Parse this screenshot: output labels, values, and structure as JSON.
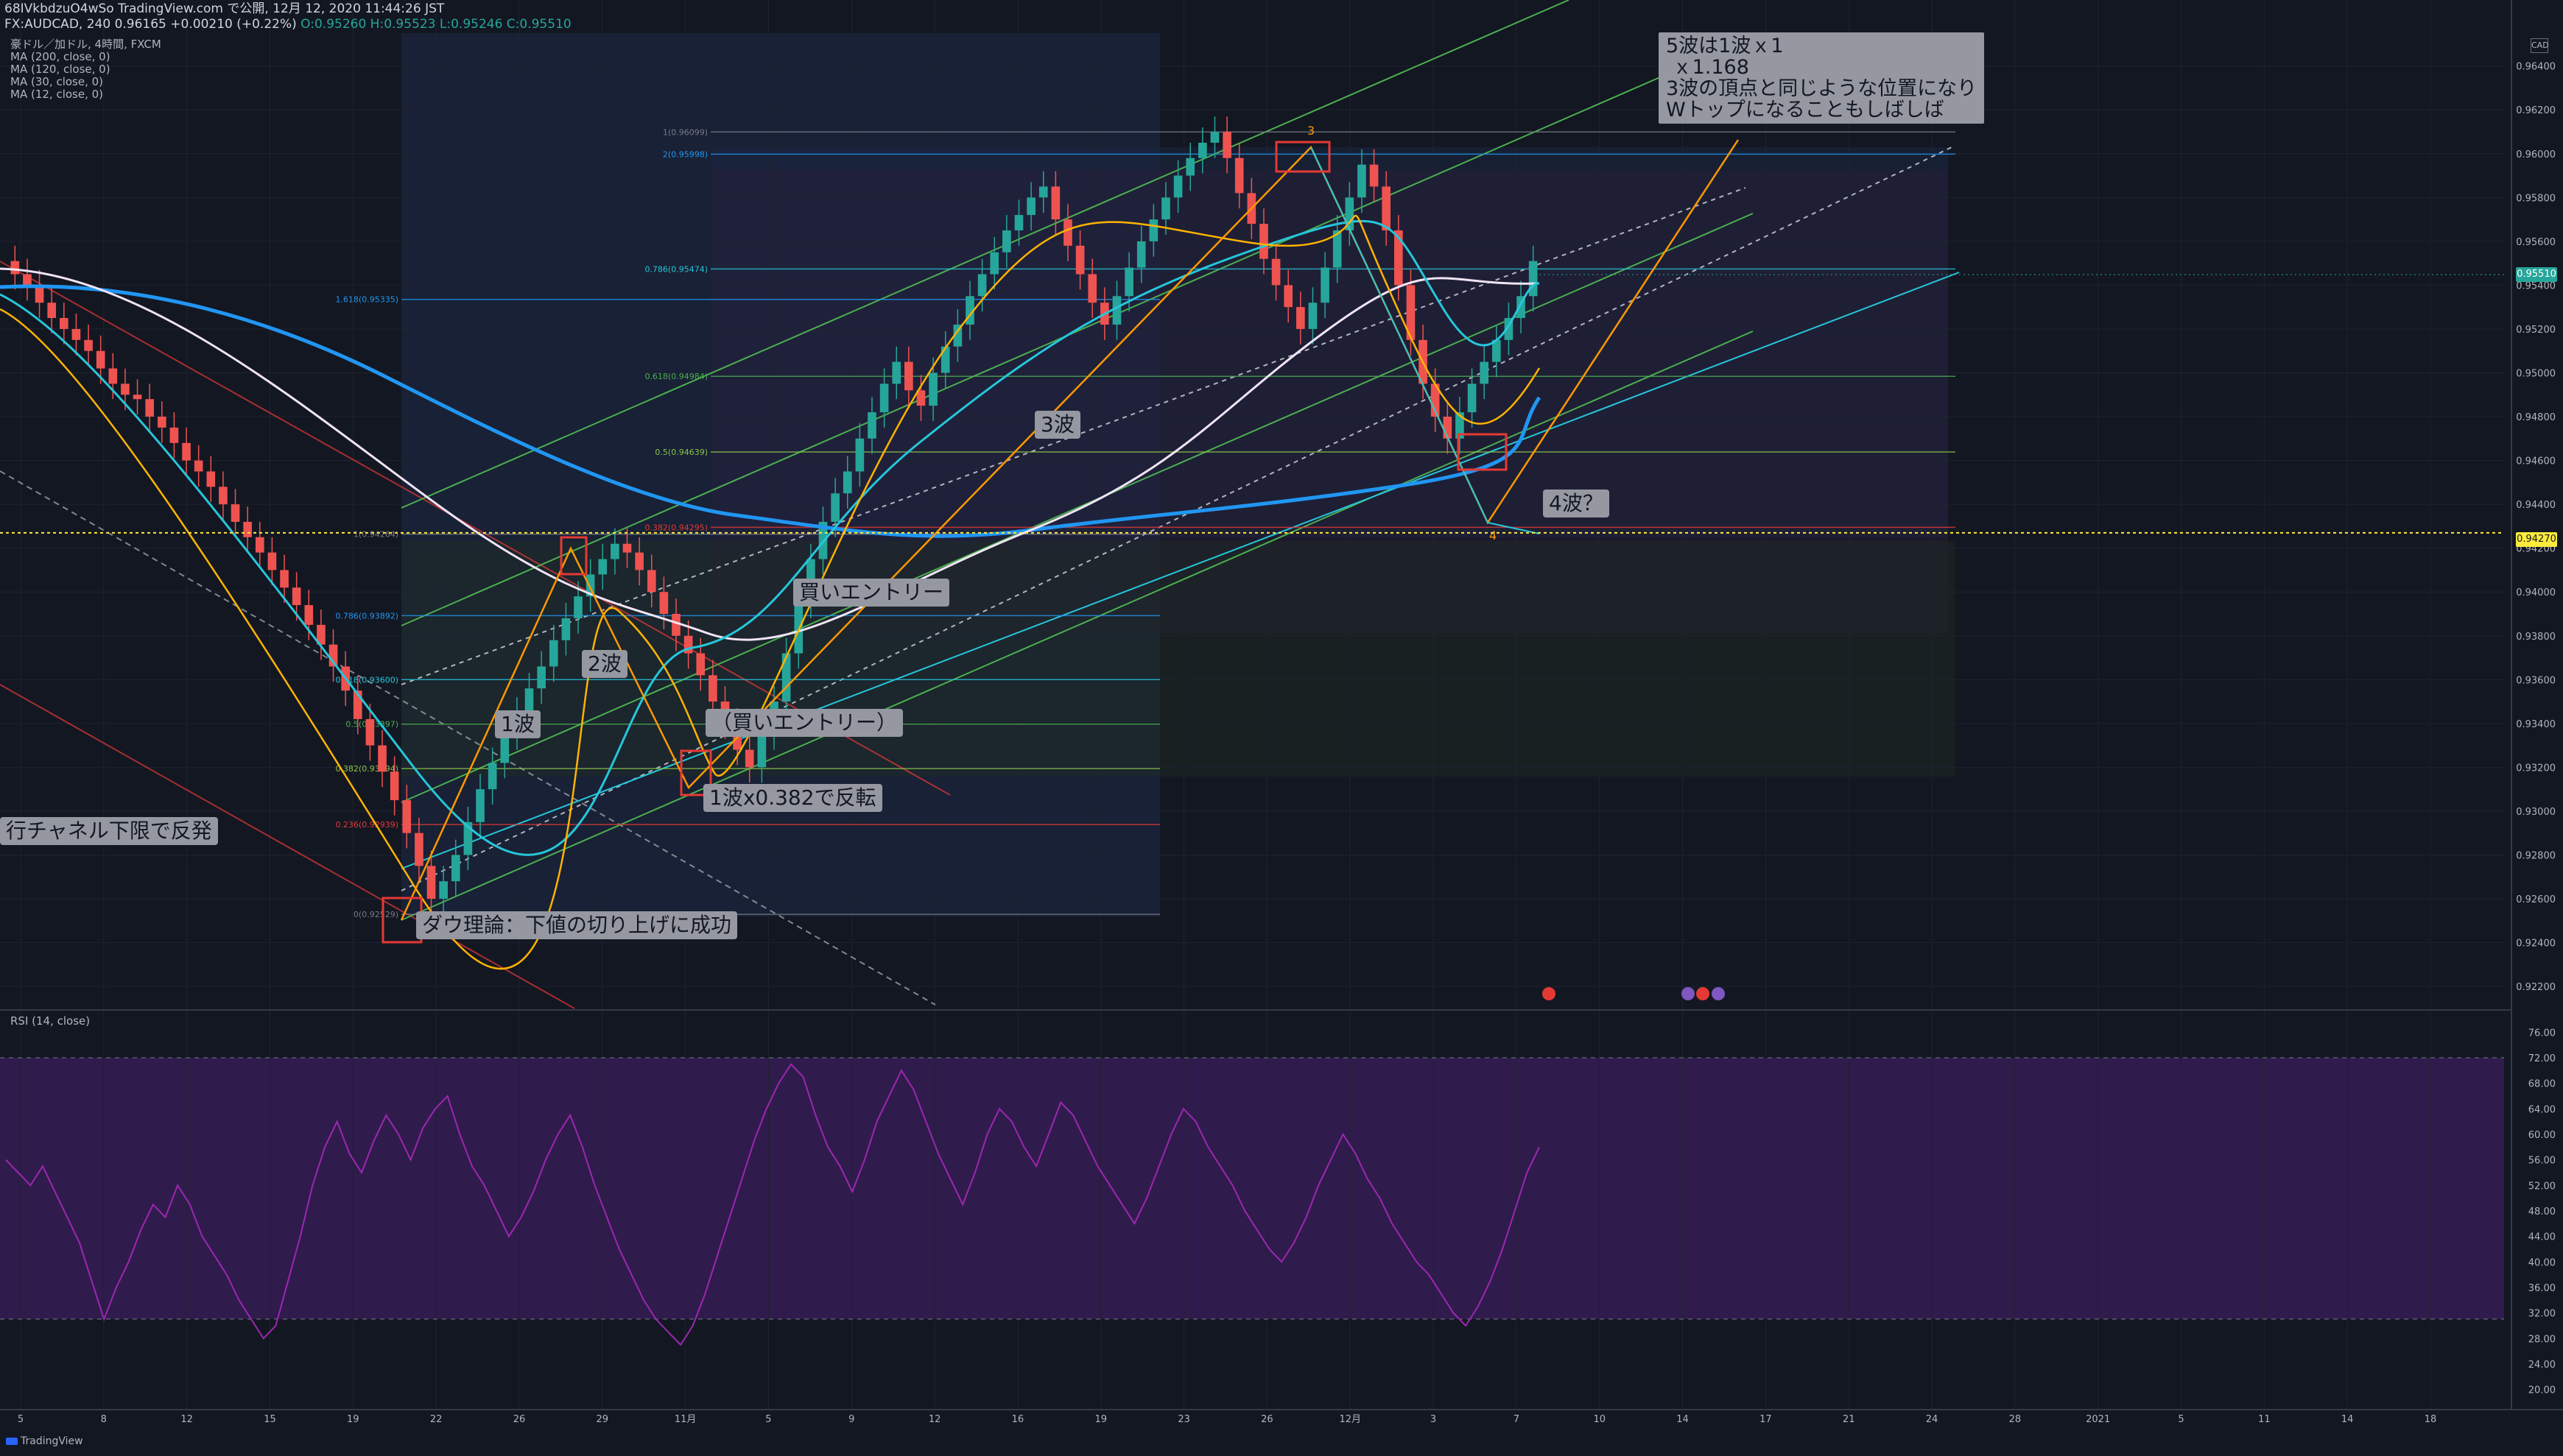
{
  "header": {
    "line1": "68IVkbdzuO4wSo TradingView.com で公開, 12月 12, 2020 11:44:26 JST",
    "symbol": "FX:AUDCAD, 240",
    "last": "0.96165",
    "change": "+0.00210 (+0.22%)",
    "ohlc": "O:0.95260 H:0.95523 L:0.95246 C:0.95510"
  },
  "legend": {
    "title": "豪ドル／加ドル, 4時間, FXCM",
    "items": [
      "MA (200, close, 0)",
      "MA (120, close, 0)",
      "MA (30, close, 0)",
      "MA (12, close, 0)"
    ]
  },
  "rsi_label": "RSI (14, close)",
  "brand": "TradingView",
  "colors": {
    "background": "#131722",
    "candle_up": "#26a69a",
    "candle_down": "#ef5350",
    "ma200": "#2196f3",
    "ma120": "#f0e4f4",
    "ma30": "#26c6da",
    "ma12": "#ffb300",
    "rsi": "#9c27b0",
    "channel": "#4caf50",
    "wave": "#ff9800",
    "fib": "#26a69a"
  },
  "annotations": {
    "channel_low": "行チャネル下限で反発",
    "dow": "ダウ理論：下値の切り上げに成功",
    "wave1": "1波",
    "wave2": "2波",
    "wave3": "3波",
    "wave4": "4波？",
    "buy1": "買いエントリー",
    "buy2": "（買いエントリー）",
    "ratio": "1波x0.382で反転",
    "note": "5波は1波ｘ1\n ｘ1.168\n3波の頂点と同じような位置になり\nWトップになることもしばしば"
  },
  "price_tags": {
    "current": "0.95510",
    "level": "0.94270"
  },
  "gear_label": "CAD",
  "chart_data": {
    "type": "candlestick",
    "title": "豪ドル／加ドル, 4時間, FXCM",
    "price_axis": {
      "ticks": [
        "0.96400",
        "0.96200",
        "0.96000",
        "0.95800",
        "0.95600",
        "0.95400",
        "0.95200",
        "0.95000",
        "0.94800",
        "0.94600",
        "0.94400",
        "0.94200",
        "0.94000",
        "0.93800",
        "0.93600",
        "0.93400",
        "0.93200",
        "0.93000",
        "0.92800",
        "0.92600",
        "0.92400",
        "0.92200"
      ],
      "range": [
        0.9215,
        0.9655
      ]
    },
    "time_axis": {
      "ticks": [
        "5",
        "8",
        "12",
        "15",
        "19",
        "22",
        "26",
        "29",
        "11月",
        "5",
        "9",
        "12",
        "16",
        "19",
        "23",
        "26",
        "12月",
        "3",
        "7",
        "10",
        "14",
        "17",
        "21",
        "24",
        "28",
        "2021",
        "5",
        "11",
        "14",
        "18"
      ]
    },
    "ohlc_last": {
      "open": 0.9526,
      "high": 0.95523,
      "low": 0.95246,
      "close": 0.9551
    },
    "horizontal_level": 0.9427,
    "fib_left": {
      "levels": [
        "1(0.94264)",
        "0.786(0.93892)",
        "0.618(0.93600)",
        "0.5(0.93397)",
        "0.382(0.93194)",
        "0.236(0.92939)",
        "0(0.92529)",
        "1.618(0.95335)"
      ],
      "values": [
        0.94264,
        0.93892,
        0.936,
        0.93397,
        0.93194,
        0.92939,
        0.92529,
        0.95335
      ]
    },
    "fib_right": {
      "levels": [
        "1(0.96099)",
        "2(0.95998)",
        "0.786(0.95474)",
        "0.618(0.94984)",
        "0.5(0.94639)",
        "0.382(0.94295)"
      ],
      "values": [
        0.96099,
        0.95998,
        0.95474,
        0.94984,
        0.94639,
        0.94295
      ]
    },
    "wave_labels": [
      "3",
      "4"
    ],
    "rsi": {
      "name": "RSI (14, close)",
      "ticks": [
        "76.00",
        "72.00",
        "68.00",
        "64.00",
        "60.00",
        "56.00",
        "52.00",
        "48.00",
        "44.00",
        "40.00",
        "36.00",
        "32.00",
        "28.00",
        "24.00",
        "20.00"
      ],
      "range": [
        18,
        78
      ],
      "bands": [
        70,
        30
      ],
      "values": [
        56,
        54,
        52,
        55,
        51,
        47,
        43,
        37,
        31,
        36,
        40,
        45,
        49,
        47,
        52,
        49,
        44,
        41,
        38,
        34,
        31,
        28,
        30,
        37,
        44,
        52,
        58,
        62,
        57,
        54,
        59,
        63,
        60,
        56,
        61,
        64,
        66,
        60,
        55,
        52,
        48,
        44,
        47,
        51,
        56,
        60,
        63,
        58,
        52,
        47,
        42,
        38,
        34,
        31,
        29,
        27,
        30,
        35,
        41,
        47,
        53,
        59,
        64,
        68,
        71,
        69,
        63,
        58,
        55,
        51,
        56,
        62,
        66,
        70,
        67,
        62,
        57,
        53,
        49,
        54,
        60,
        64,
        62,
        58,
        55,
        60,
        65,
        63,
        59,
        55,
        52,
        49,
        46,
        50,
        55,
        60,
        64,
        62,
        58,
        55,
        52,
        48,
        45,
        42,
        40,
        43,
        47,
        52,
        56,
        60,
        57,
        53,
        50,
        46,
        43,
        40,
        38,
        35,
        32,
        30,
        33,
        37,
        42,
        48,
        54,
        58
      ]
    },
    "candles_close": [
      0.9545,
      0.954,
      0.9532,
      0.9525,
      0.952,
      0.9515,
      0.951,
      0.9502,
      0.9495,
      0.949,
      0.9488,
      0.948,
      0.9475,
      0.9468,
      0.946,
      0.9455,
      0.9448,
      0.944,
      0.9432,
      0.9425,
      0.9418,
      0.941,
      0.9402,
      0.9394,
      0.9385,
      0.9376,
      0.9366,
      0.9355,
      0.9342,
      0.933,
      0.9318,
      0.9305,
      0.929,
      0.9275,
      0.926,
      0.9268,
      0.928,
      0.9295,
      0.931,
      0.9322,
      0.9335,
      0.9345,
      0.9356,
      0.9366,
      0.9378,
      0.9388,
      0.9398,
      0.9408,
      0.9415,
      0.9422,
      0.9418,
      0.941,
      0.94,
      0.939,
      0.938,
      0.9372,
      0.9362,
      0.935,
      0.934,
      0.9328,
      0.932,
      0.9335,
      0.935,
      0.9372,
      0.9395,
      0.9415,
      0.9432,
      0.9445,
      0.9455,
      0.947,
      0.9482,
      0.9495,
      0.9505,
      0.9492,
      0.9485,
      0.95,
      0.9512,
      0.9522,
      0.9535,
      0.9545,
      0.9555,
      0.9565,
      0.9572,
      0.958,
      0.9585,
      0.957,
      0.9558,
      0.9545,
      0.9532,
      0.9522,
      0.9535,
      0.9548,
      0.956,
      0.957,
      0.958,
      0.959,
      0.9598,
      0.9605,
      0.961,
      0.9598,
      0.9582,
      0.9568,
      0.9552,
      0.954,
      0.953,
      0.952,
      0.9532,
      0.9548,
      0.9565,
      0.958,
      0.9595,
      0.9585,
      0.9565,
      0.954,
      0.9515,
      0.9495,
      0.948,
      0.947,
      0.9482,
      0.9495,
      0.9505,
      0.9515,
      0.9525,
      0.9535,
      0.9551
    ]
  }
}
